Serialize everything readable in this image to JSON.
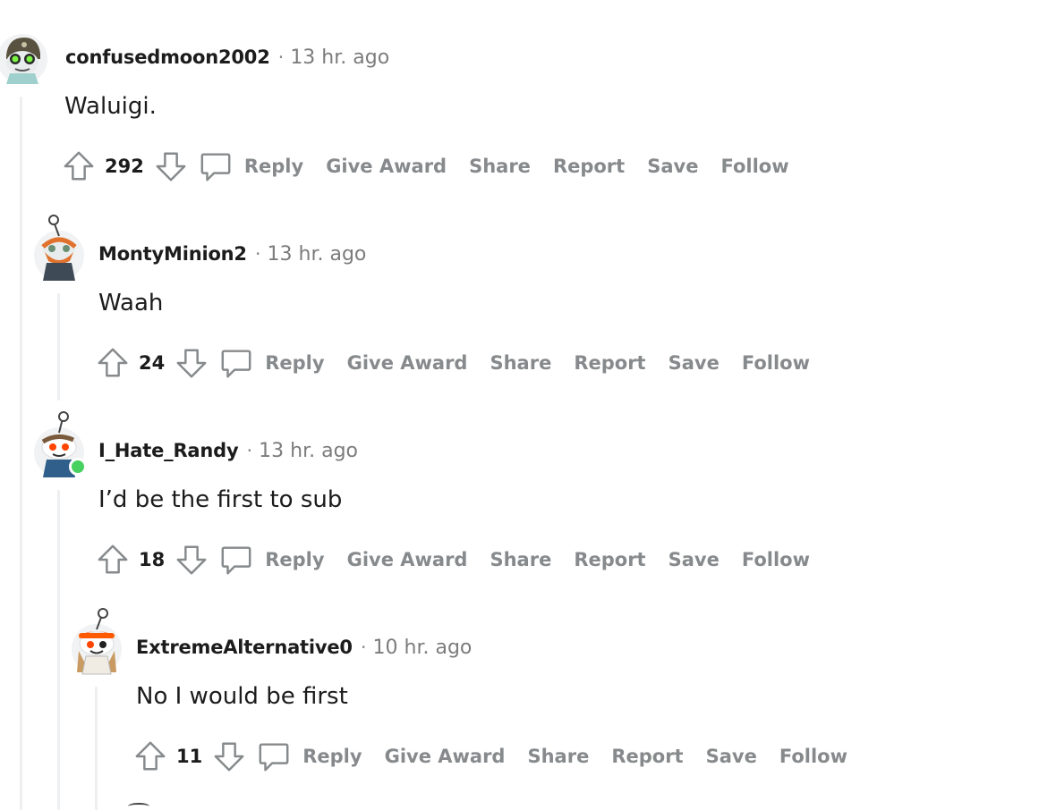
{
  "comments": [
    {
      "username": "confusedmoon2002",
      "separator": "·",
      "time": "13 hr. ago",
      "body": "Waluigi.",
      "score": "292",
      "actions": [
        "Reply",
        "Give Award",
        "Share",
        "Report",
        "Save",
        "Follow"
      ],
      "avatar_icon": "snoo-avatar-goggles-helmet",
      "online": false
    },
    {
      "username": "MontyMinion2",
      "separator": "·",
      "time": "13 hr. ago",
      "body": "Waah",
      "score": "24",
      "actions": [
        "Reply",
        "Give Award",
        "Share",
        "Report",
        "Save",
        "Follow"
      ],
      "avatar_icon": "snoo-avatar-orange-beard",
      "online": false
    },
    {
      "username": "I_Hate_Randy",
      "separator": "·",
      "time": "13 hr. ago",
      "body": "I’d be the first to sub",
      "score": "18",
      "actions": [
        "Reply",
        "Give Award",
        "Share",
        "Report",
        "Save",
        "Follow"
      ],
      "avatar_icon": "snoo-avatar-red-eyes",
      "online": true
    },
    {
      "username": "ExtremeAlternative0",
      "separator": "·",
      "time": "10 hr. ago",
      "body": "No I would be first",
      "score": "11",
      "actions": [
        "Reply",
        "Give Award",
        "Share",
        "Report",
        "Save",
        "Follow"
      ],
      "avatar_icon": "snoo-avatar-orange-bandana",
      "online": false
    }
  ],
  "colors": {
    "thread_line": "#edeff1",
    "action_gray": "#878a8c",
    "online_green": "#46d160",
    "text": "#1c1c1c"
  }
}
